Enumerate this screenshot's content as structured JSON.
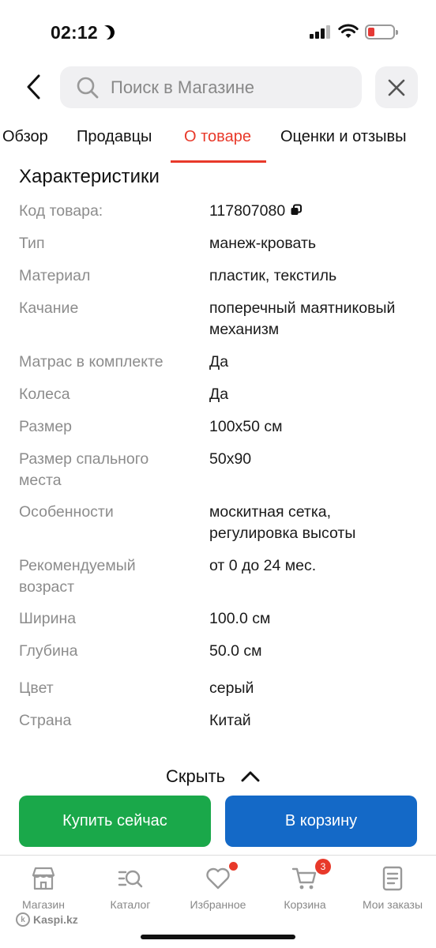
{
  "status": {
    "time": "02:12"
  },
  "search": {
    "placeholder": "Поиск в Магазине"
  },
  "tabs": [
    {
      "label": "Обзор"
    },
    {
      "label": "Продавцы"
    },
    {
      "label": "О товаре"
    },
    {
      "label": "Оценки и отзывы"
    }
  ],
  "active_tab": "О товаре",
  "section": {
    "title": "Характеристики"
  },
  "specs": [
    {
      "label": "Код товара:",
      "value": "117807080"
    },
    {
      "label": "Тип",
      "value": "манеж-кровать"
    },
    {
      "label": "Материал",
      "value": "пластик, текстиль"
    },
    {
      "label": "Качание",
      "value": "поперечный маятниковый механизм"
    },
    {
      "label": "Матрас в комплекте",
      "value": "Да"
    },
    {
      "label": "Колеса",
      "value": "Да"
    },
    {
      "label": "Размер",
      "value": "100x50 см"
    },
    {
      "label": "Размер спального места",
      "value": "50x90"
    },
    {
      "label": "Особенности",
      "value": "москитная сетка, регулировка высоты"
    },
    {
      "label": "Рекомендуемый возраст",
      "value": "от 0 до 24 мес."
    },
    {
      "label": "Ширина",
      "value": "100.0 см"
    },
    {
      "label": "Глубина",
      "value": "50.0 см"
    },
    {
      "label": "Цвет",
      "value": "серый"
    },
    {
      "label": "Страна",
      "value": "Китай"
    }
  ],
  "hide_label": "Скрыть",
  "actions": {
    "buy_now": "Купить сейчас",
    "add_to_cart": "В корзину"
  },
  "nav": [
    {
      "label": "Магазин",
      "icon": "store-icon"
    },
    {
      "label": "Каталог",
      "icon": "catalog-search-icon"
    },
    {
      "label": "Избранное",
      "icon": "heart-icon"
    },
    {
      "label": "Корзина",
      "icon": "cart-icon",
      "badge": "3"
    },
    {
      "label": "Мои заказы",
      "icon": "orders-icon"
    }
  ],
  "brand": "Kaspi.kz",
  "colors": {
    "accent": "#e8392a",
    "buy": "#1aa84a",
    "cart": "#1469c7"
  }
}
